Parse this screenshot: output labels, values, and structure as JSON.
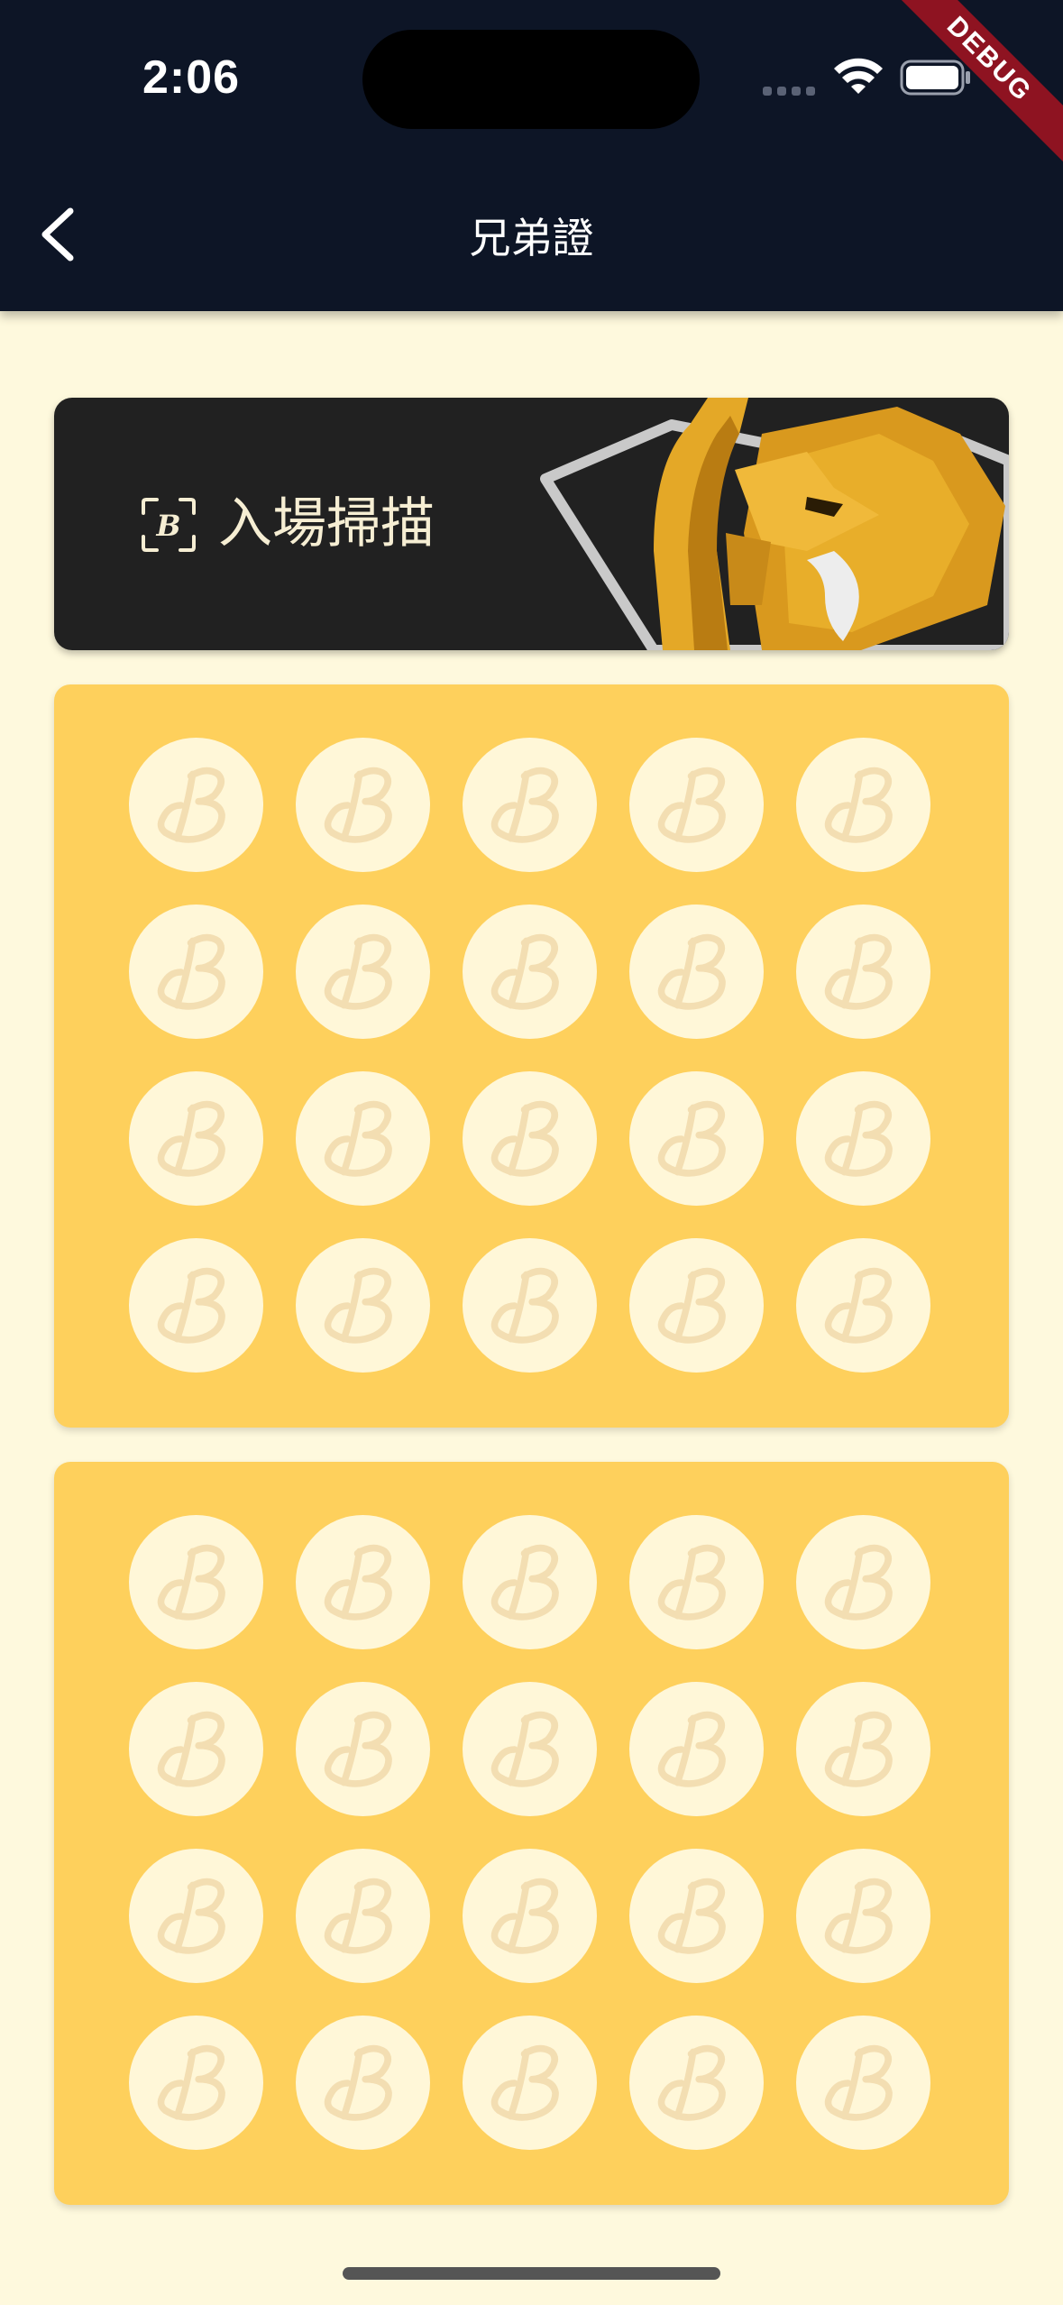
{
  "status_bar": {
    "time": "2:06"
  },
  "debug_banner": {
    "label": "DEBUG"
  },
  "header": {
    "title": "兄弟證",
    "back_icon": "chevron-left-icon"
  },
  "scan_card": {
    "label": "入場掃描",
    "icon": "qr-scan-icon",
    "background_image": "elephant-mascot"
  },
  "stamp_cards": [
    {
      "stamps_total": 20,
      "stamps_collected": 0,
      "columns": 5,
      "rows": 4
    },
    {
      "stamps_total": 20,
      "stamps_collected": 0,
      "columns": 5,
      "rows": 4
    }
  ],
  "colors": {
    "app_bar": "#0D1526",
    "page_background": "#FEF9DD",
    "scan_card_background": "#212121",
    "stamp_card_background": "#FED05C",
    "stamp_empty": "#FFF7D8",
    "stamp_logo": "#F5E0B5",
    "debug_ribbon": "#8E1321"
  }
}
